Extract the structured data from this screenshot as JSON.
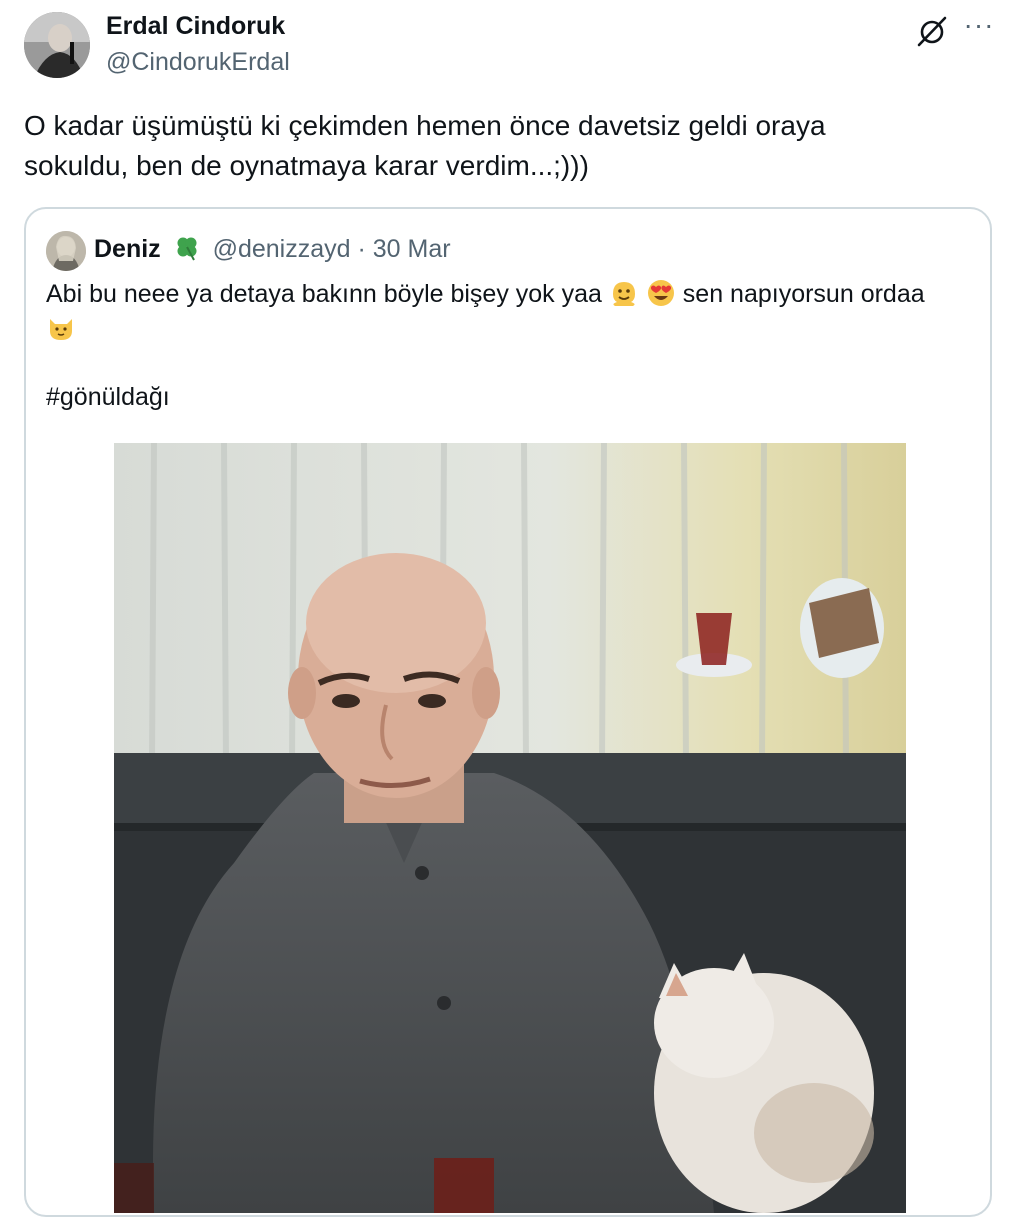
{
  "author": {
    "name": "Erdal Cindoruk",
    "handle": "@CindorukErdal"
  },
  "tweet": {
    "text": "O kadar üşümüştü ki çekimden hemen önce davetsiz geldi oraya\nsokuldu, ben de oynatmaya karar verdim...;)))"
  },
  "actions": {
    "more_label": "···"
  },
  "quote": {
    "name": "Deniz",
    "handle": "@denizzayd",
    "separator": "·",
    "date": "30 Mar",
    "text_part1": "Abi bu neee ya detaya bakınn böyle bişey yok yaa",
    "text_part2": "sen napıyorsun ordaa",
    "hashtag": "#gönüldağı"
  },
  "icons": {
    "grok": "grok-icon",
    "more": "more-icon",
    "clover": "four-leaf-clover-emoji",
    "emoji1": "melting-face-emoji",
    "emoji2": "heart-eyes-emoji",
    "emoji3": "cat-face-emoji"
  },
  "colors": {
    "text_primary": "#0f1419",
    "text_secondary": "#536471",
    "border": "#cfd9de"
  }
}
